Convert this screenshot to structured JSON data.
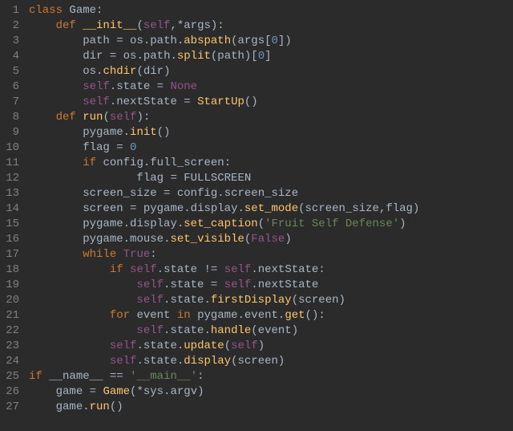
{
  "lines": [
    {
      "n": 1,
      "tokens": [
        [
          "kw",
          "class "
        ],
        [
          "name",
          "Game"
        ],
        [
          "op",
          ":"
        ]
      ]
    },
    {
      "n": 2,
      "tokens": [
        [
          "op",
          "    "
        ],
        [
          "kw",
          "def "
        ],
        [
          "fn",
          "__init__"
        ],
        [
          "op",
          "("
        ],
        [
          "self",
          "self"
        ],
        [
          "op",
          ",*"
        ],
        [
          "param",
          "args"
        ],
        [
          "op",
          "):"
        ]
      ]
    },
    {
      "n": 3,
      "tokens": [
        [
          "op",
          "        "
        ],
        [
          "name",
          "path "
        ],
        [
          "op",
          "= "
        ],
        [
          "name",
          "os"
        ],
        [
          "op",
          "."
        ],
        [
          "name",
          "path"
        ],
        [
          "op",
          "."
        ],
        [
          "fn",
          "abspath"
        ],
        [
          "op",
          "("
        ],
        [
          "name",
          "args"
        ],
        [
          "op",
          "["
        ],
        [
          "num",
          "0"
        ],
        [
          "op",
          "])"
        ]
      ]
    },
    {
      "n": 4,
      "tokens": [
        [
          "op",
          "        "
        ],
        [
          "name",
          "dir "
        ],
        [
          "op",
          "= "
        ],
        [
          "name",
          "os"
        ],
        [
          "op",
          "."
        ],
        [
          "name",
          "path"
        ],
        [
          "op",
          "."
        ],
        [
          "fn",
          "split"
        ],
        [
          "op",
          "("
        ],
        [
          "name",
          "path"
        ],
        [
          "op",
          ")["
        ],
        [
          "num",
          "0"
        ],
        [
          "op",
          "]"
        ]
      ]
    },
    {
      "n": 5,
      "tokens": [
        [
          "op",
          "        "
        ],
        [
          "name",
          "os"
        ],
        [
          "op",
          "."
        ],
        [
          "fn",
          "chdir"
        ],
        [
          "op",
          "("
        ],
        [
          "name",
          "dir"
        ],
        [
          "op",
          ")"
        ]
      ]
    },
    {
      "n": 6,
      "tokens": [
        [
          "op",
          "        "
        ],
        [
          "self",
          "self"
        ],
        [
          "op",
          "."
        ],
        [
          "name",
          "state "
        ],
        [
          "op",
          "= "
        ],
        [
          "self",
          "None"
        ]
      ]
    },
    {
      "n": 7,
      "tokens": [
        [
          "op",
          "        "
        ],
        [
          "self",
          "self"
        ],
        [
          "op",
          "."
        ],
        [
          "name",
          "nextState "
        ],
        [
          "op",
          "= "
        ],
        [
          "fn",
          "StartUp"
        ],
        [
          "op",
          "()"
        ]
      ]
    },
    {
      "n": 8,
      "tokens": [
        [
          "op",
          "    "
        ],
        [
          "kw",
          "def "
        ],
        [
          "fn",
          "run"
        ],
        [
          "op",
          "("
        ],
        [
          "self",
          "self"
        ],
        [
          "op",
          "):"
        ]
      ]
    },
    {
      "n": 9,
      "tokens": [
        [
          "op",
          "        "
        ],
        [
          "name",
          "pygame"
        ],
        [
          "op",
          "."
        ],
        [
          "fn",
          "init"
        ],
        [
          "op",
          "()"
        ]
      ]
    },
    {
      "n": 10,
      "tokens": [
        [
          "op",
          "        "
        ],
        [
          "name",
          "flag "
        ],
        [
          "op",
          "= "
        ],
        [
          "num",
          "0"
        ]
      ]
    },
    {
      "n": 11,
      "tokens": [
        [
          "op",
          "        "
        ],
        [
          "kw",
          "if "
        ],
        [
          "name",
          "config"
        ],
        [
          "op",
          "."
        ],
        [
          "name",
          "full_screen"
        ],
        [
          "op",
          ":"
        ]
      ]
    },
    {
      "n": 12,
      "tokens": [
        [
          "op",
          "                "
        ],
        [
          "name",
          "flag "
        ],
        [
          "op",
          "= "
        ],
        [
          "name",
          "FULLSCREEN"
        ]
      ]
    },
    {
      "n": 13,
      "tokens": [
        [
          "op",
          "        "
        ],
        [
          "name",
          "screen_size "
        ],
        [
          "op",
          "= "
        ],
        [
          "name",
          "config"
        ],
        [
          "op",
          "."
        ],
        [
          "name",
          "screen_size"
        ]
      ]
    },
    {
      "n": 14,
      "tokens": [
        [
          "op",
          "        "
        ],
        [
          "name",
          "screen "
        ],
        [
          "op",
          "= "
        ],
        [
          "name",
          "pygame"
        ],
        [
          "op",
          "."
        ],
        [
          "name",
          "display"
        ],
        [
          "op",
          "."
        ],
        [
          "fn",
          "set_mode"
        ],
        [
          "op",
          "("
        ],
        [
          "name",
          "screen_size"
        ],
        [
          "op",
          ","
        ],
        [
          "name",
          "flag"
        ],
        [
          "op",
          ")"
        ]
      ]
    },
    {
      "n": 15,
      "tokens": [
        [
          "op",
          "        "
        ],
        [
          "name",
          "pygame"
        ],
        [
          "op",
          "."
        ],
        [
          "name",
          "display"
        ],
        [
          "op",
          "."
        ],
        [
          "fn",
          "set_caption"
        ],
        [
          "op",
          "("
        ],
        [
          "str",
          "'Fruit Self Defense'"
        ],
        [
          "op",
          ")"
        ]
      ]
    },
    {
      "n": 16,
      "tokens": [
        [
          "op",
          "        "
        ],
        [
          "name",
          "pygame"
        ],
        [
          "op",
          "."
        ],
        [
          "name",
          "mouse"
        ],
        [
          "op",
          "."
        ],
        [
          "fn",
          "set_visible"
        ],
        [
          "op",
          "("
        ],
        [
          "self",
          "False"
        ],
        [
          "op",
          ")"
        ]
      ]
    },
    {
      "n": 17,
      "tokens": [
        [
          "op",
          "        "
        ],
        [
          "kw",
          "while "
        ],
        [
          "self",
          "True"
        ],
        [
          "op",
          ":"
        ]
      ]
    },
    {
      "n": 18,
      "tokens": [
        [
          "op",
          "            "
        ],
        [
          "kw",
          "if "
        ],
        [
          "self",
          "self"
        ],
        [
          "op",
          "."
        ],
        [
          "name",
          "state "
        ],
        [
          "op",
          "!= "
        ],
        [
          "self",
          "self"
        ],
        [
          "op",
          "."
        ],
        [
          "name",
          "nextState"
        ],
        [
          "op",
          ":"
        ]
      ]
    },
    {
      "n": 19,
      "tokens": [
        [
          "op",
          "                "
        ],
        [
          "self",
          "self"
        ],
        [
          "op",
          "."
        ],
        [
          "name",
          "state "
        ],
        [
          "op",
          "= "
        ],
        [
          "self",
          "self"
        ],
        [
          "op",
          "."
        ],
        [
          "name",
          "nextState"
        ]
      ]
    },
    {
      "n": 20,
      "tokens": [
        [
          "op",
          "                "
        ],
        [
          "self",
          "self"
        ],
        [
          "op",
          "."
        ],
        [
          "name",
          "state"
        ],
        [
          "op",
          "."
        ],
        [
          "fn",
          "firstDisplay"
        ],
        [
          "op",
          "("
        ],
        [
          "name",
          "screen"
        ],
        [
          "op",
          ")"
        ]
      ]
    },
    {
      "n": 21,
      "tokens": [
        [
          "op",
          "            "
        ],
        [
          "kw",
          "for "
        ],
        [
          "name",
          "event "
        ],
        [
          "kw",
          "in "
        ],
        [
          "name",
          "pygame"
        ],
        [
          "op",
          "."
        ],
        [
          "name",
          "event"
        ],
        [
          "op",
          "."
        ],
        [
          "fn",
          "get"
        ],
        [
          "op",
          "():"
        ]
      ]
    },
    {
      "n": 22,
      "tokens": [
        [
          "op",
          "                "
        ],
        [
          "self",
          "self"
        ],
        [
          "op",
          "."
        ],
        [
          "name",
          "state"
        ],
        [
          "op",
          "."
        ],
        [
          "fn",
          "handle"
        ],
        [
          "op",
          "("
        ],
        [
          "name",
          "event"
        ],
        [
          "op",
          ")"
        ]
      ]
    },
    {
      "n": 23,
      "tokens": [
        [
          "op",
          "            "
        ],
        [
          "self",
          "self"
        ],
        [
          "op",
          "."
        ],
        [
          "name",
          "state"
        ],
        [
          "op",
          "."
        ],
        [
          "fn",
          "update"
        ],
        [
          "op",
          "("
        ],
        [
          "self",
          "self"
        ],
        [
          "op",
          ")"
        ]
      ]
    },
    {
      "n": 24,
      "tokens": [
        [
          "op",
          "            "
        ],
        [
          "self",
          "self"
        ],
        [
          "op",
          "."
        ],
        [
          "name",
          "state"
        ],
        [
          "op",
          "."
        ],
        [
          "fn",
          "display"
        ],
        [
          "op",
          "("
        ],
        [
          "name",
          "screen"
        ],
        [
          "op",
          ")"
        ]
      ]
    },
    {
      "n": 25,
      "tokens": [
        [
          "kw",
          "if "
        ],
        [
          "name",
          "__name__ "
        ],
        [
          "op",
          "== "
        ],
        [
          "str",
          "'__main__'"
        ],
        [
          "op",
          ":"
        ]
      ]
    },
    {
      "n": 26,
      "tokens": [
        [
          "op",
          "    "
        ],
        [
          "name",
          "game "
        ],
        [
          "op",
          "= "
        ],
        [
          "fn",
          "Game"
        ],
        [
          "op",
          "(*"
        ],
        [
          "name",
          "sys"
        ],
        [
          "op",
          "."
        ],
        [
          "name",
          "argv"
        ],
        [
          "op",
          ")"
        ]
      ]
    },
    {
      "n": 27,
      "tokens": [
        [
          "op",
          "    "
        ],
        [
          "name",
          "game"
        ],
        [
          "op",
          "."
        ],
        [
          "fn",
          "run"
        ],
        [
          "op",
          "()"
        ]
      ]
    }
  ]
}
